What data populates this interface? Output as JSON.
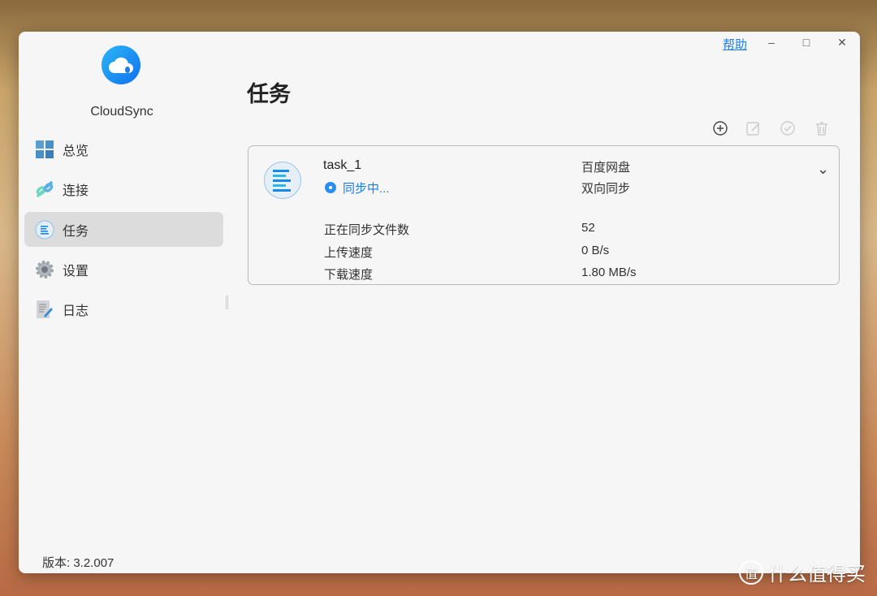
{
  "window": {
    "help": "帮助",
    "minimize": "–",
    "maximize": "□",
    "close": "✕"
  },
  "app": {
    "name": "CloudSync",
    "version": "版本: 3.2.007"
  },
  "sidebar": {
    "items": [
      {
        "label": "总览"
      },
      {
        "label": "连接"
      },
      {
        "label": "任务"
      },
      {
        "label": "设置"
      },
      {
        "label": "日志"
      }
    ]
  },
  "main": {
    "title": "任务"
  },
  "task": {
    "name": "task_1",
    "status": "同步中...",
    "cloud": "百度网盘",
    "direction": "双向同步",
    "stats": [
      {
        "label": "正在同步文件数",
        "value": "52"
      },
      {
        "label": "上传速度",
        "value": "0 B/s"
      },
      {
        "label": "下载速度",
        "value": "1.80 MB/s"
      }
    ]
  },
  "watermark": {
    "icon": "值",
    "text": "什么值得买"
  },
  "colors": {
    "accent": "#1a7fe0",
    "active": "#dcdcdc"
  }
}
